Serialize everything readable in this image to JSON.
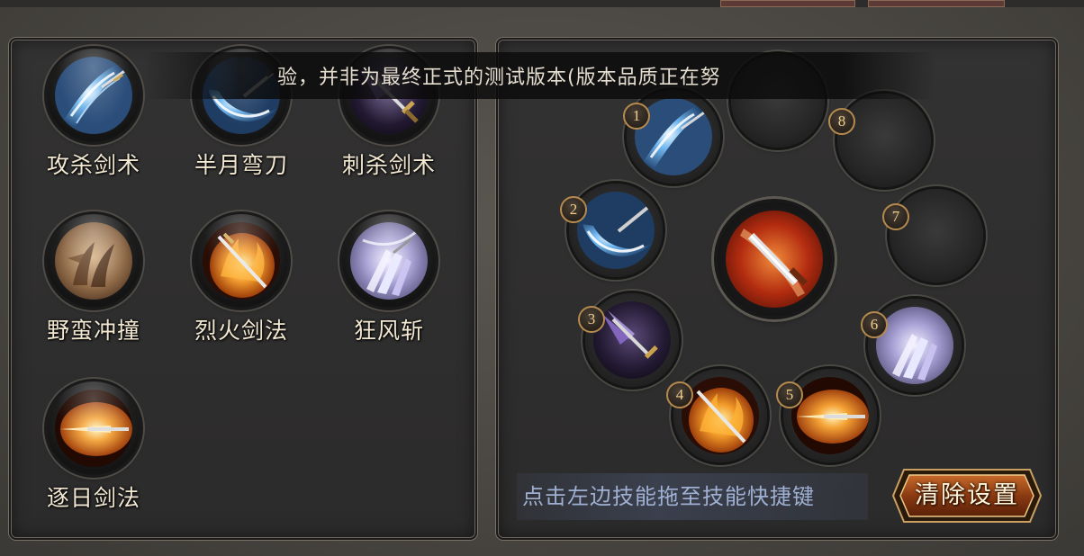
{
  "notice": {
    "text": "验，并非为最终正式的测试版本(版本品质正在努"
  },
  "skill_list": [
    {
      "name": "攻杀剑术",
      "icon": "slash-sword-icon"
    },
    {
      "name": "半月弯刀",
      "icon": "half-moon-blade-icon"
    },
    {
      "name": "刺杀剑术",
      "icon": "thrust-sword-icon"
    },
    {
      "name": "野蛮冲撞",
      "icon": "savage-charge-icon"
    },
    {
      "name": "烈火剑法",
      "icon": "flame-sword-icon"
    },
    {
      "name": "狂风斩",
      "icon": "gale-slash-icon"
    },
    {
      "name": "逐日剑法",
      "icon": "sun-chase-sword-icon"
    }
  ],
  "hotkey_slots": [
    {
      "number": "1",
      "skill_icon": "slash-sword-icon"
    },
    {
      "number": "2",
      "skill_icon": "half-moon-blade-icon"
    },
    {
      "number": "3",
      "skill_icon": "thrust-sword-icon"
    },
    {
      "number": "4",
      "skill_icon": "flame-sword-icon"
    },
    {
      "number": "5",
      "skill_icon": "sun-chase-sword-icon"
    },
    {
      "number": "6",
      "skill_icon": "gale-slash-icon"
    },
    {
      "number": "7",
      "skill_icon": ""
    },
    {
      "number": "8",
      "skill_icon": ""
    }
  ],
  "center_skill": {
    "icon": "main-attack-icon"
  },
  "hint_text": "点击左边技能拖至技能快捷键",
  "clear_button": "清除设置"
}
